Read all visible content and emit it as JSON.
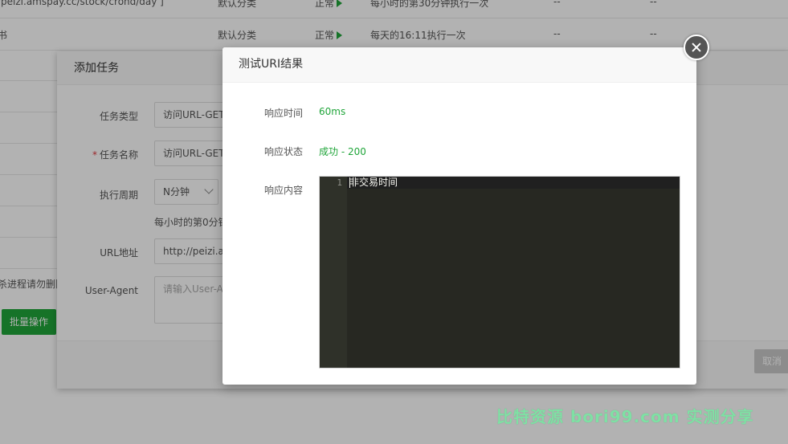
{
  "background_table": {
    "rows": [
      {
        "name": "/peizi.amspay.cc/stock/crond/day ]",
        "category": "默认分类",
        "status": "正常",
        "schedule": "每小时的第30分钟执行一次",
        "col5": "--",
        "col6": "--"
      },
      {
        "name": "书",
        "category": "默认分类",
        "status": "正常",
        "schedule": "每天的16:11执行一次",
        "col5": "--",
        "col6": "--"
      }
    ],
    "kill_text": "杀进程请勿删除",
    "batch_button": "批量操作"
  },
  "add_task": {
    "title": "添加任务",
    "fields": {
      "task_type_label": "任务类型",
      "task_type_value": "访问URL-GET",
      "task_name_label": "任务名称",
      "task_name_value": "访问URL-GET",
      "period_label": "执行周期",
      "period_value": "N分钟",
      "period_hint": "每小时的第0分钟",
      "url_label": "URL地址",
      "url_value": "http://peizi.a",
      "ua_label": "User-Agent",
      "ua_placeholder": "请输入User-A"
    },
    "cancel_button": "取消"
  },
  "result_dialog": {
    "title": "测试URI结果",
    "response_time_label": "响应时间",
    "response_time_value": "60ms",
    "response_status_label": "响应状态",
    "response_status_value": "成功 - 200",
    "response_content_label": "响应内容",
    "editor": {
      "line_number": "1",
      "content": "非交易时间"
    }
  },
  "watermark": "比特资源 bori99.com 实测分享",
  "colors": {
    "success": "#20a53a",
    "editor_bg": "#272822",
    "watermark": "#7fe0a4"
  }
}
